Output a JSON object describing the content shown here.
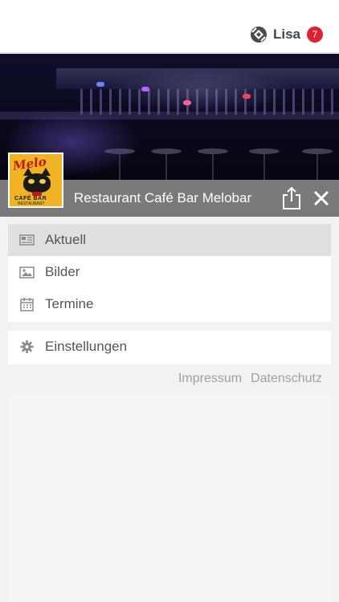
{
  "header": {
    "user_name": "Lisa",
    "notification_count": "7",
    "logo_icon": "yellow-app-logo-icon"
  },
  "venue": {
    "name": "Restaurant Café Bar Melobar",
    "share_icon": "share-icon",
    "close_icon": "close-icon",
    "logo": {
      "text": "Melo",
      "subtitle": "CAFÉ BAR",
      "subtitle2": "RESTAURANT"
    }
  },
  "menu": {
    "items": [
      {
        "label": "Aktuell",
        "icon": "newspaper-icon",
        "active": true
      },
      {
        "label": "Bilder",
        "icon": "image-icon",
        "active": false
      },
      {
        "label": "Termine",
        "icon": "calendar-icon",
        "active": false
      }
    ],
    "settings": {
      "label": "Einstellungen",
      "icon": "gear-icon"
    }
  },
  "footer": {
    "impressum": "Impressum",
    "datenschutz": "Datenschutz"
  },
  "colors": {
    "badge": "#e0202e",
    "title_bar": "#7a7a7a",
    "active_item": "#e0e0e0",
    "logo_bg": "#f0b323"
  }
}
